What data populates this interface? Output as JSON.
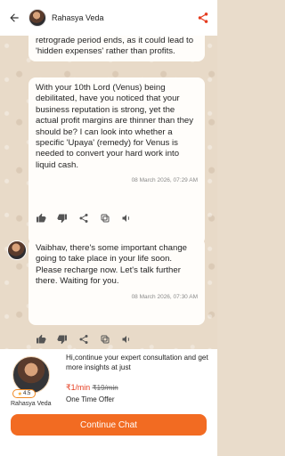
{
  "header": {
    "title": "Rahasya Veda"
  },
  "chat": {
    "top_partial": "retrograde period ends, as it could lead to 'hidden expenses' rather than profits.",
    "message_1": "With your 10th Lord (Venus) being debilitated, have you noticed that your business reputation is strong, yet the actual profit margins are thinner than they should be? I can look into whether a specific 'Upaya' (remedy) for Venus is needed to convert your hard work into liquid cash.",
    "message_1_time": "08 March 2026, 07:29 AM",
    "message_2": "Vaibhav, there's some important change going to take place in your life soon. Please recharge now. Let's talk further there. Waiting for you.",
    "message_2_time": "08 March 2026, 07:30 AM"
  },
  "offer": {
    "rating": "4.5",
    "astrologer": "Rahasya Veda",
    "text": "Hi,continue your expert consultation and get more insights at just",
    "price_new": "₹1/min",
    "price_old": "₹19/min",
    "one_time": "One Time Offer",
    "cta": "Continue Chat"
  },
  "icons": {
    "back": "arrow-left-icon",
    "share": "share-icon",
    "like": "thumbs-up-icon",
    "dislike": "thumbs-down-icon",
    "forward": "share-icon",
    "copy": "copy-icon",
    "speaker": "speaker-icon"
  },
  "colors": {
    "accent": "#f26b22",
    "price": "#e53b1e"
  }
}
